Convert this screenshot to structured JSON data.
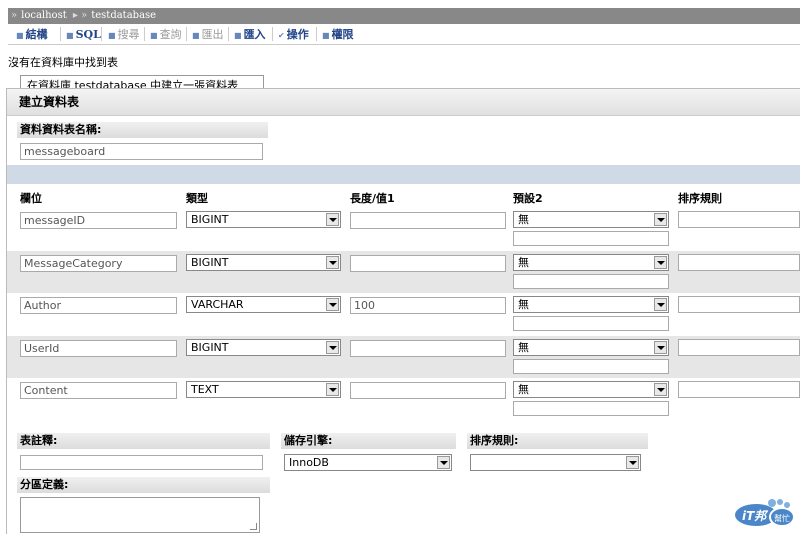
{
  "breadcrumb": {
    "server": "localhost",
    "database": "testdatabase"
  },
  "tabs": [
    {
      "label": "結構",
      "disabled": false
    },
    {
      "label": "SQL",
      "disabled": false
    },
    {
      "label": "搜尋",
      "disabled": true
    },
    {
      "label": "查詢",
      "disabled": true
    },
    {
      "label": "匯出",
      "disabled": true
    },
    {
      "label": "匯入",
      "disabled": false
    },
    {
      "label": "操作",
      "disabled": false
    },
    {
      "label": "權限",
      "disabled": false
    }
  ],
  "message": "沒有在資料庫中找到表",
  "hidden_create_label": "在資料庫 testdatabase 中建立一張資料表",
  "panel": {
    "title": "建立資料表",
    "table_name_label": "資料資料表名稱:",
    "table_name_value": "messageboard"
  },
  "columns_header": {
    "field": "欄位",
    "type": "類型",
    "length": "長度/值1",
    "default": "預設2",
    "collation": "排序規則"
  },
  "rows": [
    {
      "name": "messageID",
      "type": "BIGINT",
      "length": "",
      "default": "無"
    },
    {
      "name": "MessageCategory",
      "type": "BIGINT",
      "length": "",
      "default": "無"
    },
    {
      "name": "Author",
      "type": "VARCHAR",
      "length": "100",
      "default": "無"
    },
    {
      "name": "UserId",
      "type": "BIGINT",
      "length": "",
      "default": "無"
    },
    {
      "name": "Content",
      "type": "TEXT",
      "length": "",
      "default": "無"
    }
  ],
  "footer": {
    "comment_label": "表註釋:",
    "engine_label": "儲存引擎:",
    "engine_value": "InnoDB",
    "collation_label": "排序規則:",
    "collation_value": "",
    "partition_label": "分區定義:"
  },
  "logo_text": {
    "main": "iT邦",
    "sub": "幫忙"
  }
}
